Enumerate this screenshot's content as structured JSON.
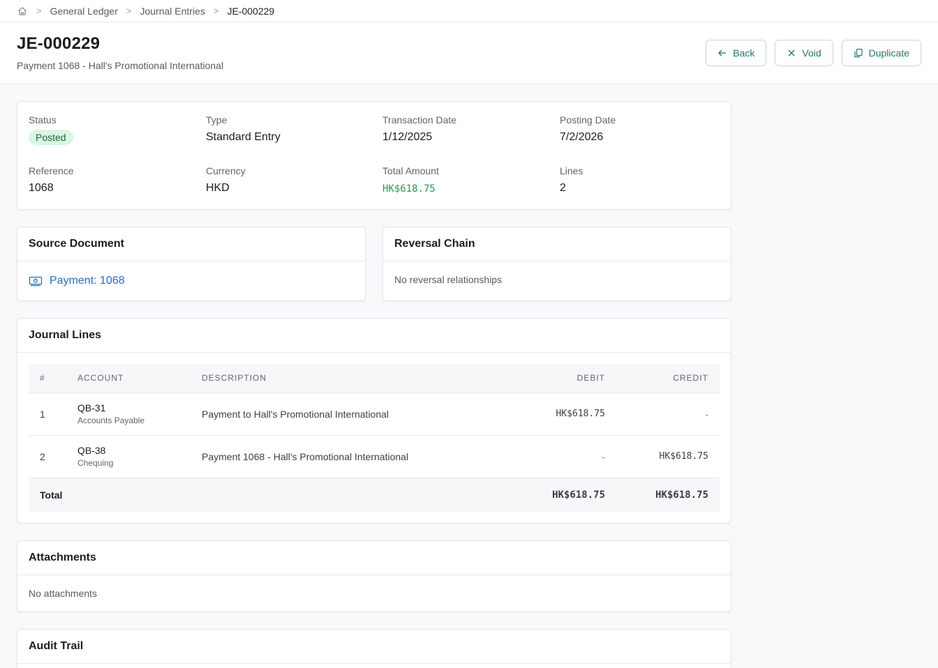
{
  "breadcrumb": {
    "items": [
      "General Ledger",
      "Journal Entries"
    ],
    "current": "JE-000229"
  },
  "header": {
    "title": "JE-000229",
    "subtitle": "Payment 1068 - Hall's Promotional International",
    "actions": {
      "back": "Back",
      "void": "Void",
      "duplicate": "Duplicate"
    }
  },
  "summary": {
    "status_label": "Status",
    "status_value": "Posted",
    "type_label": "Type",
    "type_value": "Standard Entry",
    "transaction_date_label": "Transaction Date",
    "transaction_date_value": "1/12/2025",
    "posting_date_label": "Posting Date",
    "posting_date_value": "7/2/2026",
    "reference_label": "Reference",
    "reference_value": "1068",
    "currency_label": "Currency",
    "currency_value": "HKD",
    "total_amount_label": "Total Amount",
    "total_amount_value": "HK$618.75",
    "lines_label": "Lines",
    "lines_value": "2"
  },
  "source_document": {
    "title": "Source Document",
    "link_label": "Payment: 1068"
  },
  "reversal_chain": {
    "title": "Reversal Chain",
    "empty_text": "No reversal relationships"
  },
  "journal_lines": {
    "title": "Journal Lines",
    "columns": {
      "num": "#",
      "account": "ACCOUNT",
      "description": "DESCRIPTION",
      "debit": "DEBIT",
      "credit": "CREDIT"
    },
    "rows": [
      {
        "num": "1",
        "account_code": "QB-31",
        "account_name": "Accounts Payable",
        "description": "Payment to Hall's Promotional International",
        "debit": "HK$618.75",
        "credit": "-"
      },
      {
        "num": "2",
        "account_code": "QB-38",
        "account_name": "Chequing",
        "description": "Payment 1068 - Hall's Promotional International",
        "debit": "-",
        "credit": "HK$618.75"
      }
    ],
    "total": {
      "label": "Total",
      "debit": "HK$618.75",
      "credit": "HK$618.75"
    }
  },
  "attachments": {
    "title": "Attachments",
    "empty_text": "No attachments"
  },
  "audit_trail": {
    "title": "Audit Trail"
  },
  "colors": {
    "accent": "#1f7a6a",
    "amount_green": "#1f9d55",
    "link_blue": "#1f6fc7",
    "badge_bg": "#d9f5e3"
  },
  "icons": {
    "home": "home-icon",
    "back": "arrow-left-icon",
    "void": "x-icon",
    "duplicate": "copy-icon",
    "payment": "banknote-icon"
  }
}
